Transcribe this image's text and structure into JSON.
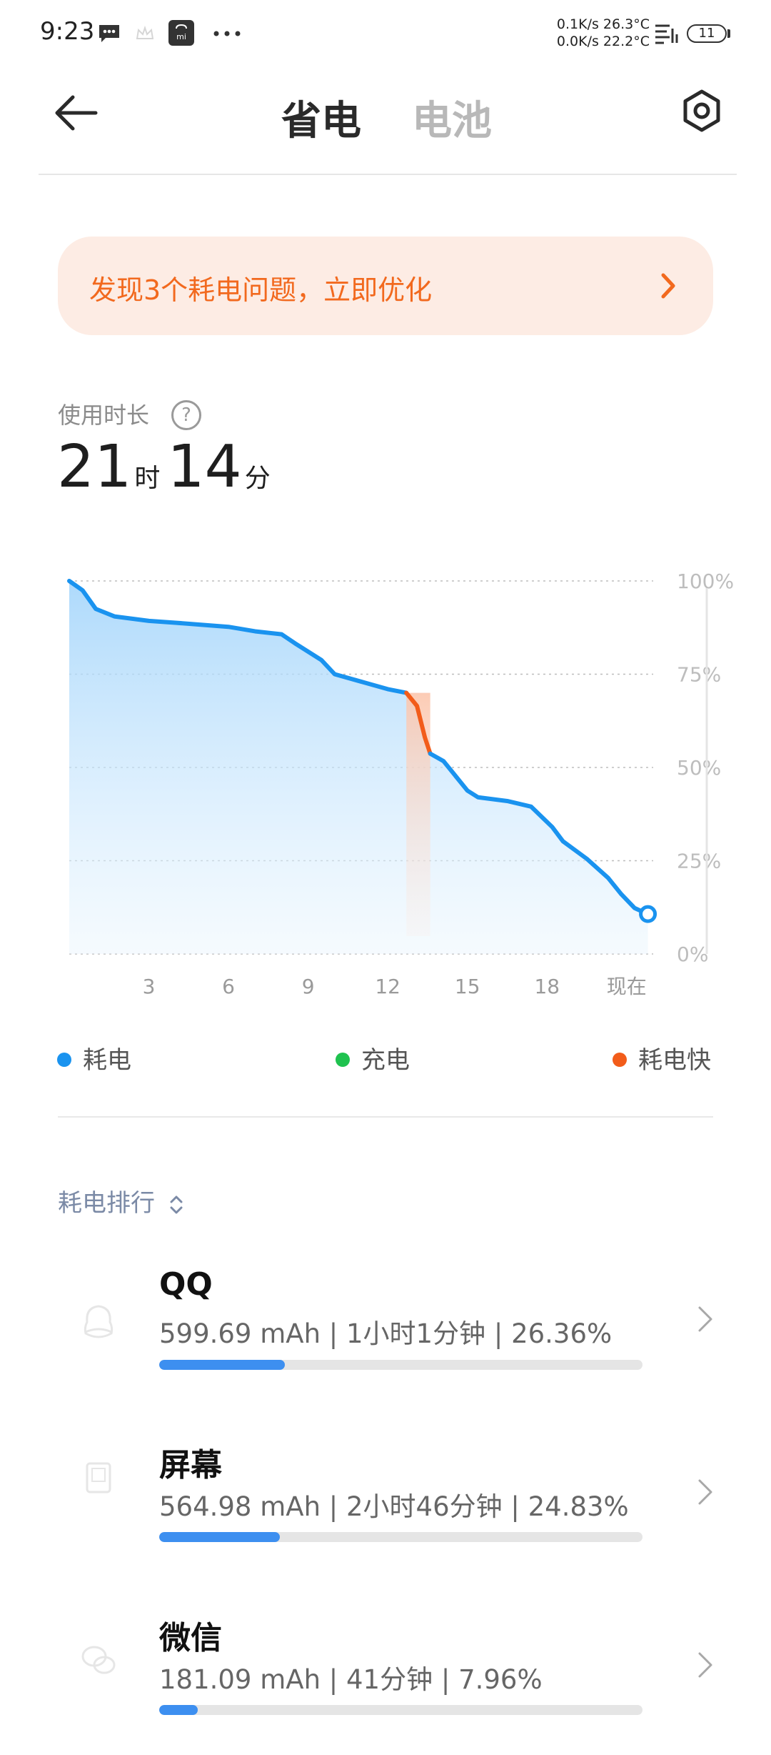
{
  "status_bar": {
    "time": "9:23",
    "net_up": "0.1K/s",
    "temp1": "26.3°C",
    "net_down": "0.0K/s",
    "temp2": "22.2°C",
    "battery": "11",
    "icons": [
      "message-icon",
      "crown-icon",
      "mi-store-icon",
      "more-dots-icon",
      "signal-icon",
      "battery-icon"
    ]
  },
  "header": {
    "tab_active": "省电",
    "tab_inactive": "电池",
    "back_icon": "back-arrow-icon",
    "settings_icon": "settings-icon"
  },
  "alert": {
    "text": "发现3个耗电问题，立即优化",
    "color": "#f2691e",
    "background": "#fdece4"
  },
  "usage": {
    "label": "使用时长",
    "hours": "21",
    "hours_unit": "时",
    "minutes": "14",
    "minutes_unit": "分"
  },
  "chart_data": {
    "type": "area",
    "y_ticks": [
      "100%",
      "75%",
      "50%",
      "25%",
      "0%"
    ],
    "x_ticks": [
      "3",
      "6",
      "9",
      "12",
      "15",
      "18",
      "现在"
    ],
    "x_tick_values": [
      3,
      6,
      9,
      12,
      15,
      18,
      21
    ],
    "xlim": [
      0,
      22
    ],
    "ylim": [
      0,
      100
    ],
    "grid": true,
    "series": [
      {
        "name": "耗电",
        "color": "#1a93ef",
        "points": [
          [
            0,
            100
          ],
          [
            0.5,
            97.5
          ],
          [
            1,
            92.5
          ],
          [
            1.7,
            90.5
          ],
          [
            3,
            89.3
          ],
          [
            4,
            88.8
          ],
          [
            6,
            87.7
          ],
          [
            7,
            86.5
          ],
          [
            8,
            85.7
          ],
          [
            8.5,
            83.3
          ],
          [
            9.5,
            78.8
          ],
          [
            10,
            75
          ],
          [
            11,
            73
          ],
          [
            12,
            71
          ],
          [
            12.7,
            70
          ]
        ]
      },
      {
        "name": "耗电快",
        "color": "#f25c1a",
        "points": [
          [
            12.7,
            70
          ],
          [
            13.1,
            66.5
          ],
          [
            13.4,
            58
          ],
          [
            13.6,
            53.7
          ]
        ]
      },
      {
        "name": "耗电",
        "color": "#1a93ef",
        "points": [
          [
            13.6,
            53.7
          ],
          [
            14.1,
            51.7
          ],
          [
            15,
            43.8
          ],
          [
            15.4,
            42
          ],
          [
            16.5,
            41
          ],
          [
            17.4,
            39.5
          ],
          [
            18.2,
            34
          ],
          [
            18.6,
            30.2
          ],
          [
            19.5,
            25.5
          ],
          [
            20.3,
            20.4
          ],
          [
            20.8,
            16
          ],
          [
            21.3,
            12.3
          ],
          [
            21.8,
            10.7
          ]
        ]
      }
    ]
  },
  "legend": [
    {
      "label": "耗电",
      "color": "#1a93ef"
    },
    {
      "label": "充电",
      "color": "#1fc24f"
    },
    {
      "label": "耗电快",
      "color": "#f25c1a"
    }
  ],
  "ranking": {
    "header": "耗电排行",
    "items": [
      {
        "name": "QQ",
        "detail": "599.69 mAh | 1小时1分钟 | 26.36%",
        "share": 0.26,
        "icon": "qq-icon"
      },
      {
        "name": "屏幕",
        "detail": "564.98 mAh | 2小时46分钟 | 24.83%",
        "share": 0.25,
        "icon": "screen-icon"
      },
      {
        "name": "微信",
        "detail": "181.09 mAh | 41分钟 | 7.96%",
        "share": 0.08,
        "icon": "wechat-icon"
      }
    ]
  }
}
